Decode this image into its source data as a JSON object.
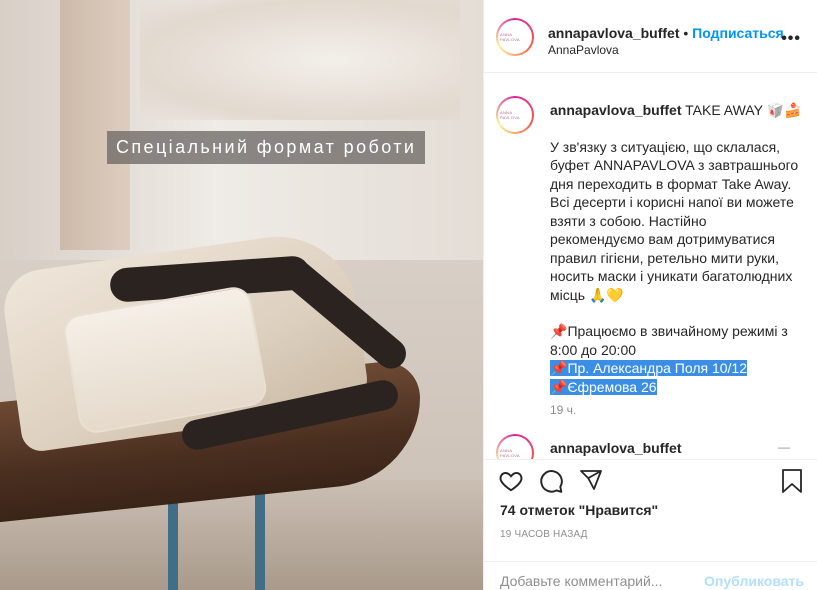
{
  "photo": {
    "overlay_title": "Спеціальний формат роботи"
  },
  "header": {
    "avatar_text": "ANNA PAVLOVA",
    "username": "annapavlova_buffet",
    "separator": " • ",
    "follow_label": "Подписаться",
    "location": "AnnaPavlova",
    "more_label": "•••"
  },
  "caption": {
    "username": "annapavlova_buffet",
    "title": "TAKE AWAY",
    "title_emoji": "🥡🍰",
    "body": "У зв'язку з ситуацією, що склалася, буфет ANNAPAVLOVA з завтрашнього дня переходить в формат Take Away. Всі десерти і корисні напої ви можете взяти з собою. Настійно рекомендуємо вам дотримуватися правил гігієни, ретельно мити руки, носить маски і уникати багатолюдних місць",
    "body_emoji": "🙏💛",
    "pin": "📌",
    "hours": "Працюємо в звичайному режимі з 8:00 до 20:00",
    "address1": "Пр. Александра Поля 10/12",
    "address2": "Єфремова 26",
    "time": "19 ч."
  },
  "comment2": {
    "username": "annapavlova_buffet",
    "dots": "—"
  },
  "actions": {
    "likes": "74 отметок \"Нравится\"",
    "post_time": "19 ЧАСОВ НАЗАД",
    "comment_placeholder": "Добавьте комментарий...",
    "publish_label": "Опубликовать"
  },
  "colors": {
    "link_blue": "#0095f6",
    "selection": "#3a8ee6",
    "pin_red": "#e0284a",
    "muted": "#8e8e8e",
    "publish_disabled": "#b2dffc"
  },
  "icons": [
    "heart-icon",
    "comment-icon",
    "share-icon",
    "bookmark-icon",
    "pin-icon"
  ]
}
